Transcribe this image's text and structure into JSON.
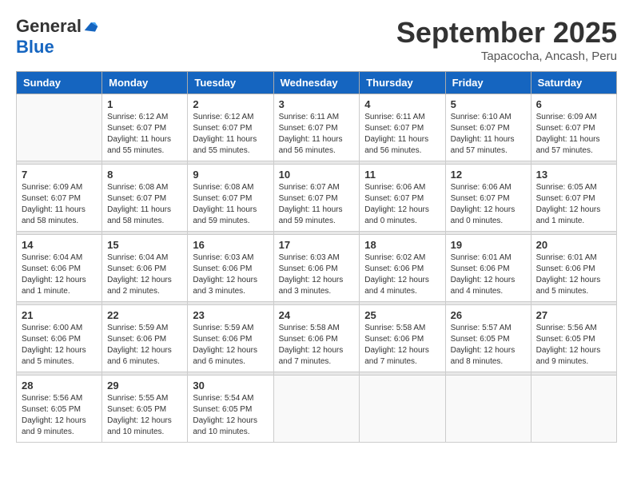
{
  "logo": {
    "general": "General",
    "blue": "Blue"
  },
  "header": {
    "month": "September 2025",
    "location": "Tapacocha, Ancash, Peru"
  },
  "weekdays": [
    "Sunday",
    "Monday",
    "Tuesday",
    "Wednesday",
    "Thursday",
    "Friday",
    "Saturday"
  ],
  "weeks": [
    [
      {
        "day": "",
        "info": ""
      },
      {
        "day": "1",
        "info": "Sunrise: 6:12 AM\nSunset: 6:07 PM\nDaylight: 11 hours\nand 55 minutes."
      },
      {
        "day": "2",
        "info": "Sunrise: 6:12 AM\nSunset: 6:07 PM\nDaylight: 11 hours\nand 55 minutes."
      },
      {
        "day": "3",
        "info": "Sunrise: 6:11 AM\nSunset: 6:07 PM\nDaylight: 11 hours\nand 56 minutes."
      },
      {
        "day": "4",
        "info": "Sunrise: 6:11 AM\nSunset: 6:07 PM\nDaylight: 11 hours\nand 56 minutes."
      },
      {
        "day": "5",
        "info": "Sunrise: 6:10 AM\nSunset: 6:07 PM\nDaylight: 11 hours\nand 57 minutes."
      },
      {
        "day": "6",
        "info": "Sunrise: 6:09 AM\nSunset: 6:07 PM\nDaylight: 11 hours\nand 57 minutes."
      }
    ],
    [
      {
        "day": "7",
        "info": "Sunrise: 6:09 AM\nSunset: 6:07 PM\nDaylight: 11 hours\nand 58 minutes."
      },
      {
        "day": "8",
        "info": "Sunrise: 6:08 AM\nSunset: 6:07 PM\nDaylight: 11 hours\nand 58 minutes."
      },
      {
        "day": "9",
        "info": "Sunrise: 6:08 AM\nSunset: 6:07 PM\nDaylight: 11 hours\nand 59 minutes."
      },
      {
        "day": "10",
        "info": "Sunrise: 6:07 AM\nSunset: 6:07 PM\nDaylight: 11 hours\nand 59 minutes."
      },
      {
        "day": "11",
        "info": "Sunrise: 6:06 AM\nSunset: 6:07 PM\nDaylight: 12 hours\nand 0 minutes."
      },
      {
        "day": "12",
        "info": "Sunrise: 6:06 AM\nSunset: 6:07 PM\nDaylight: 12 hours\nand 0 minutes."
      },
      {
        "day": "13",
        "info": "Sunrise: 6:05 AM\nSunset: 6:07 PM\nDaylight: 12 hours\nand 1 minute."
      }
    ],
    [
      {
        "day": "14",
        "info": "Sunrise: 6:04 AM\nSunset: 6:06 PM\nDaylight: 12 hours\nand 1 minute."
      },
      {
        "day": "15",
        "info": "Sunrise: 6:04 AM\nSunset: 6:06 PM\nDaylight: 12 hours\nand 2 minutes."
      },
      {
        "day": "16",
        "info": "Sunrise: 6:03 AM\nSunset: 6:06 PM\nDaylight: 12 hours\nand 3 minutes."
      },
      {
        "day": "17",
        "info": "Sunrise: 6:03 AM\nSunset: 6:06 PM\nDaylight: 12 hours\nand 3 minutes."
      },
      {
        "day": "18",
        "info": "Sunrise: 6:02 AM\nSunset: 6:06 PM\nDaylight: 12 hours\nand 4 minutes."
      },
      {
        "day": "19",
        "info": "Sunrise: 6:01 AM\nSunset: 6:06 PM\nDaylight: 12 hours\nand 4 minutes."
      },
      {
        "day": "20",
        "info": "Sunrise: 6:01 AM\nSunset: 6:06 PM\nDaylight: 12 hours\nand 5 minutes."
      }
    ],
    [
      {
        "day": "21",
        "info": "Sunrise: 6:00 AM\nSunset: 6:06 PM\nDaylight: 12 hours\nand 5 minutes."
      },
      {
        "day": "22",
        "info": "Sunrise: 5:59 AM\nSunset: 6:06 PM\nDaylight: 12 hours\nand 6 minutes."
      },
      {
        "day": "23",
        "info": "Sunrise: 5:59 AM\nSunset: 6:06 PM\nDaylight: 12 hours\nand 6 minutes."
      },
      {
        "day": "24",
        "info": "Sunrise: 5:58 AM\nSunset: 6:06 PM\nDaylight: 12 hours\nand 7 minutes."
      },
      {
        "day": "25",
        "info": "Sunrise: 5:58 AM\nSunset: 6:06 PM\nDaylight: 12 hours\nand 7 minutes."
      },
      {
        "day": "26",
        "info": "Sunrise: 5:57 AM\nSunset: 6:05 PM\nDaylight: 12 hours\nand 8 minutes."
      },
      {
        "day": "27",
        "info": "Sunrise: 5:56 AM\nSunset: 6:05 PM\nDaylight: 12 hours\nand 9 minutes."
      }
    ],
    [
      {
        "day": "28",
        "info": "Sunrise: 5:56 AM\nSunset: 6:05 PM\nDaylight: 12 hours\nand 9 minutes."
      },
      {
        "day": "29",
        "info": "Sunrise: 5:55 AM\nSunset: 6:05 PM\nDaylight: 12 hours\nand 10 minutes."
      },
      {
        "day": "30",
        "info": "Sunrise: 5:54 AM\nSunset: 6:05 PM\nDaylight: 12 hours\nand 10 minutes."
      },
      {
        "day": "",
        "info": ""
      },
      {
        "day": "",
        "info": ""
      },
      {
        "day": "",
        "info": ""
      },
      {
        "day": "",
        "info": ""
      }
    ]
  ]
}
